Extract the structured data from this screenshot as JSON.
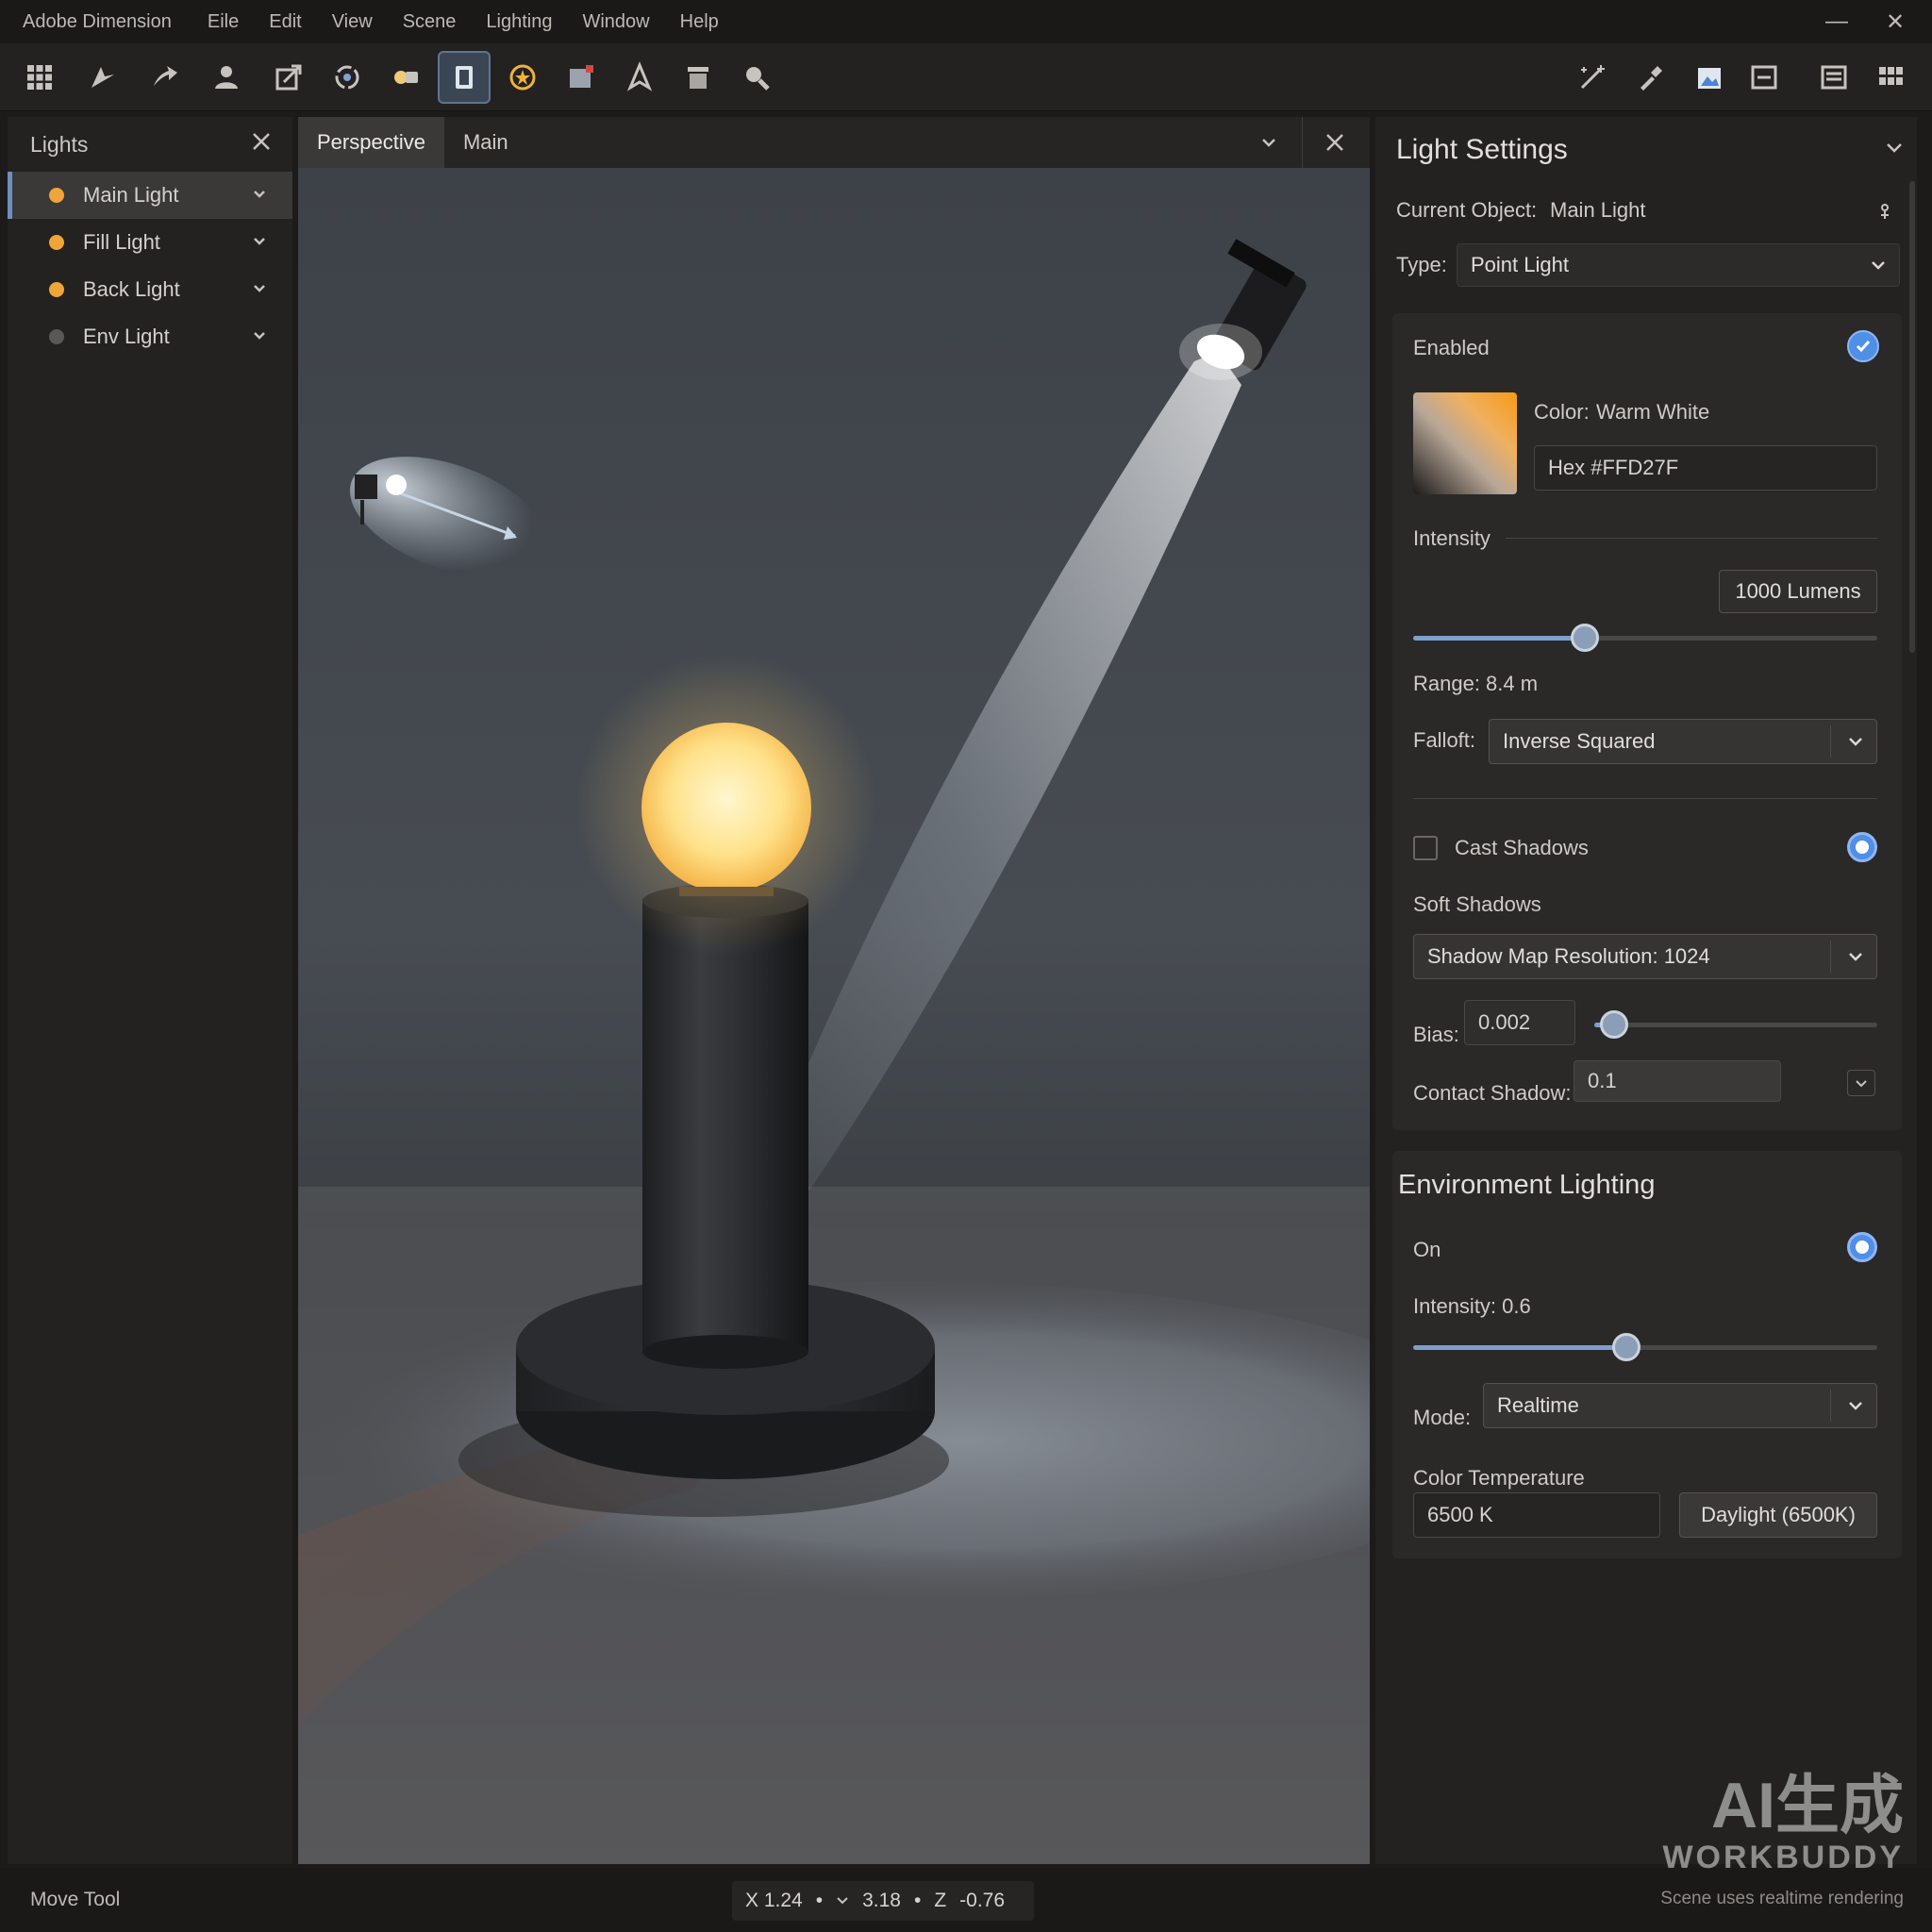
{
  "menubar": {
    "app_title": "Adobe Dimension",
    "items": [
      "Eile",
      "Edit",
      "View",
      "Scene",
      "Lighting",
      "Window",
      "Help"
    ],
    "minimize": "—",
    "close": "✕"
  },
  "toolbar": {
    "left_tools": [
      "apps-grid-icon",
      "select-arrow-icon",
      "direct-select-arrow-icon",
      "person-icon",
      "scale-icon",
      "orbit-icon",
      "spotlight-icon",
      "frame-tool-icon",
      "sun-icon",
      "image-light-icon",
      "pen-icon",
      "cylinder-icon",
      "search-icon"
    ],
    "active_tool": "frame-tool-icon",
    "right_tools": [
      "magic-wand-icon",
      "eyedropper-icon",
      "render-preview-icon",
      "minus-box-icon",
      "panel-icon",
      "grid-icon"
    ]
  },
  "lights_panel": {
    "title": "Lights",
    "items": [
      {
        "label": "Main Light",
        "color": "#f0a43a",
        "selected": true
      },
      {
        "label": "Fill Light",
        "color": "#f0a43a",
        "selected": false
      },
      {
        "label": "Back Light",
        "color": "#f0a43a",
        "selected": false
      },
      {
        "label": "Env Light",
        "color": "#5a5856",
        "selected": false
      }
    ]
  },
  "viewport": {
    "tabs": [
      "Perspective",
      "Main"
    ],
    "active_tab": "Perspective"
  },
  "light_settings": {
    "title": "Light Settings",
    "current_object_label": "Current Object:",
    "current_object_value": "Main Light",
    "type_label": "Type:",
    "type_value": "Point Light",
    "enabled_label": "Enabled",
    "color_label": "Color:",
    "color_value": "Warm White",
    "hex_label": "Hex #FFD27F",
    "intensity_label": "Intensity",
    "intensity_value": "1000 Lumens",
    "intensity_slider": 0.37,
    "range_label": "Range: 8.4 m",
    "falloff_label": "Falloft:",
    "falloff_value": "Inverse Squared",
    "cast_shadows_label": "Cast Shadows",
    "soft_shadows_label": "Soft Shadows",
    "shadow_map_value": "Shadow Map Resolution: 1024",
    "bias_label": "Bias:",
    "bias_value": "0.002",
    "bias_slider": 0.07,
    "contact_shadow_label": "Contact Shadow:",
    "contact_shadow_value": "0.1"
  },
  "environment": {
    "title": "Environment Lighting",
    "on_label": "On",
    "intensity_label": "Intensity: 0.6",
    "intensity_slider": 0.46,
    "mode_label": "Mode:",
    "mode_value": "Realtime",
    "color_temp_label": "Color Temperature",
    "color_temp_value": "6500 K",
    "preset_label": "Daylight (6500K)"
  },
  "statusbar": {
    "tool_label": "Move Tool",
    "x_label": "X 1.24",
    "dot": "•",
    "y_value": "3.18",
    "z_label": "Z",
    "z_value": "-0.76",
    "right_text": "Scene uses realtime rendering",
    "watermark_top": "AI生成",
    "watermark_bottom": "WORKBUDDY"
  },
  "colors": {
    "accent": "#4f8fe8",
    "warm_light": "#ffd27f"
  }
}
